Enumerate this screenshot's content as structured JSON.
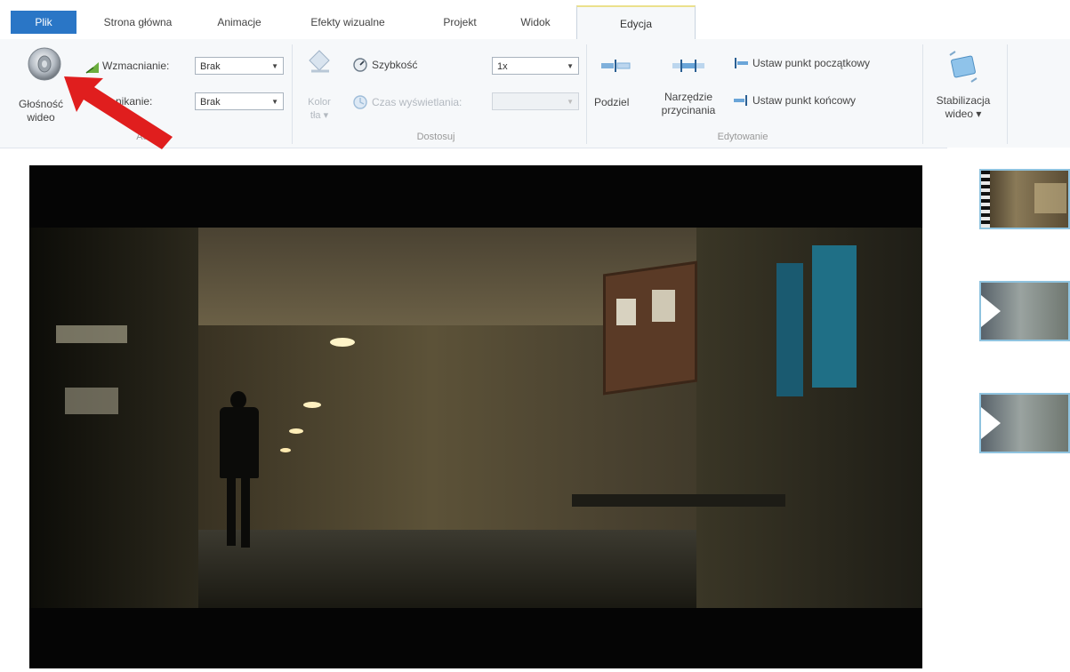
{
  "tabs": [
    {
      "label": "Plik"
    },
    {
      "label": "Strona główna"
    },
    {
      "label": "Animacje"
    },
    {
      "label": "Efekty wizualne"
    },
    {
      "label": "Projekt"
    },
    {
      "label": "Widok"
    },
    {
      "label": "Edycja"
    }
  ],
  "audio_group": {
    "volume_label": "Głośność wideo",
    "volume_label_line1": "Głośność",
    "volume_label_line2": "wideo",
    "fade_in_label": "Wzmacnianie:",
    "fade_in_value": "Brak",
    "fade_out_label": "Zanikanie:",
    "fade_out_label_visible": "nikanie:",
    "fade_out_value": "Brak",
    "group_label": "Audio",
    "group_label_visible": "Au"
  },
  "adjust_group": {
    "bg_color_label_line1": "Kolor",
    "bg_color_label_line2": "tła",
    "speed_label": "Szybkość",
    "speed_value": "1x",
    "duration_label": "Czas wyświetlania:",
    "duration_value": "",
    "group_label": "Dostosuj"
  },
  "edit_group": {
    "split_label": "Podziel",
    "trim_label_line1": "Narzędzie",
    "trim_label_line2": "przycinania",
    "set_start_label": "Ustaw punkt początkowy",
    "set_end_label": "Ustaw punkt końcowy",
    "group_label": "Edytowanie"
  },
  "stabilize": {
    "label_line1": "Stabilizacja",
    "label_line2": "wideo"
  },
  "colors": {
    "file_tab": "#2a76c6",
    "annotation_arrow": "#e01e1e",
    "thumb_border": "#8fc3df",
    "active_tab_top": "#ebe08c"
  },
  "annotation": {
    "type": "red-arrow",
    "points_to": "volume-button"
  }
}
